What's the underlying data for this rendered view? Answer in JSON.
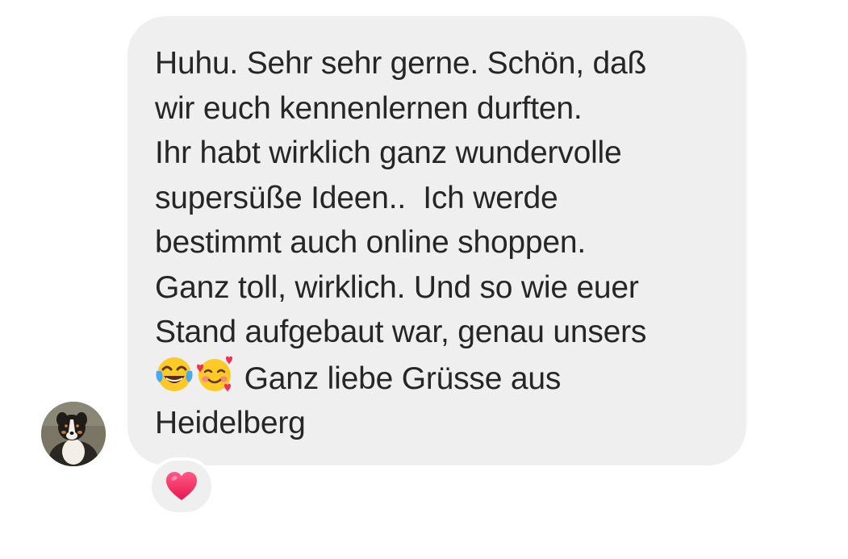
{
  "message": {
    "lines": [
      "Huhu. Sehr sehr gerne. Schön, daß",
      "wir euch kennenlernen durften.",
      "Ihr habt wirklich ganz wundervolle",
      "supersüße Ideen..  Ich werde",
      "bestimmt auch online shoppen.",
      "Ganz toll, wirklich. Und so wie euer",
      "Stand aufgebaut war, genau unsers",
      " Ganz liebe Grüsse aus",
      "Heidelberg"
    ],
    "emojis": [
      "tears-of-joy-icon",
      "smiling-face-with-hearts-icon"
    ]
  },
  "reaction": {
    "icon": "heart-icon",
    "color": "#f0306a"
  },
  "colors": {
    "bubble": "#efefef",
    "text": "#262626",
    "background": "#ffffff"
  }
}
